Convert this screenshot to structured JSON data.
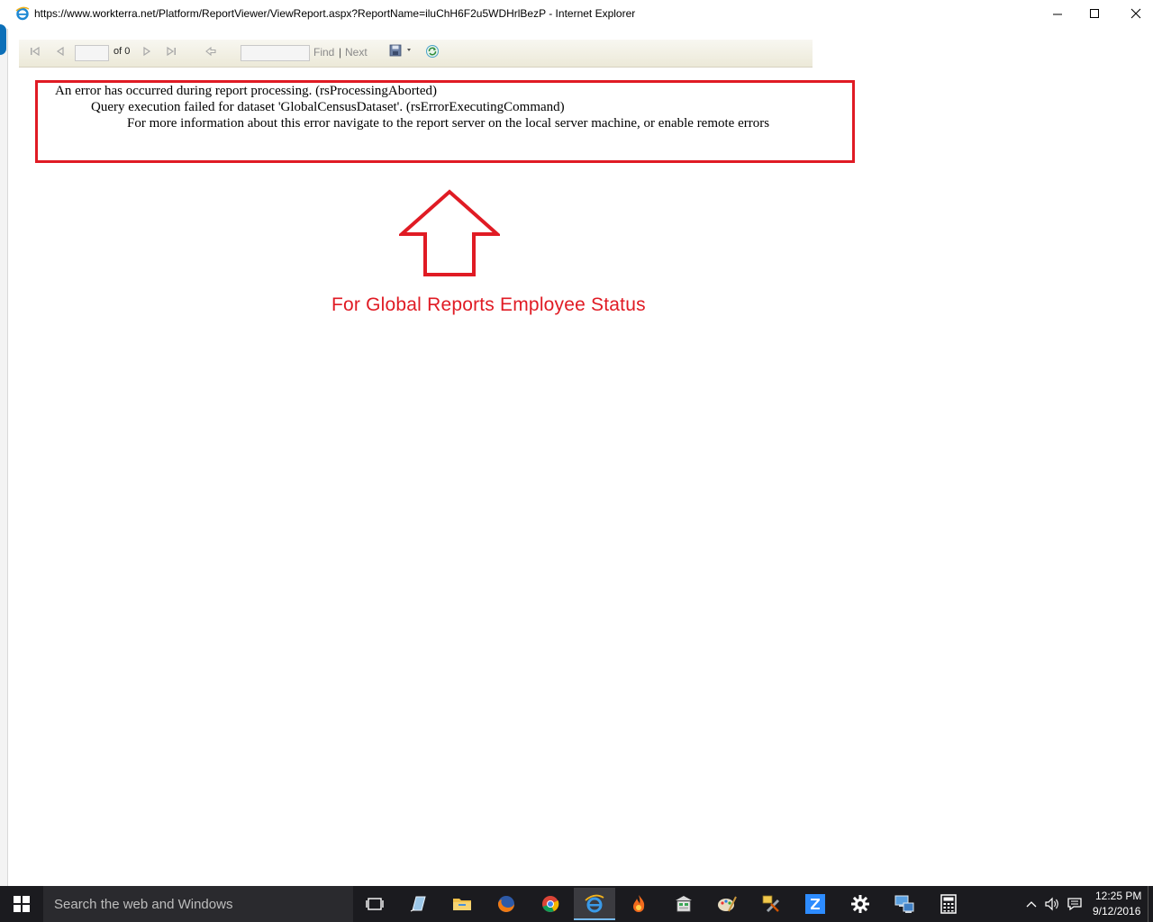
{
  "window": {
    "title": "https://www.workterra.net/Platform/ReportViewer/ViewReport.aspx?ReportName=iluChH6F2u5WDHrlBezP - Internet Explorer"
  },
  "toolbar": {
    "page_value": "",
    "page_of": "of 0",
    "find_value": "",
    "find_label": "Find",
    "separator": "|",
    "next_label": "Next"
  },
  "error": {
    "line1": "An error has occurred during report processing. (rsProcessingAborted)",
    "line2": "Query execution failed for dataset 'GlobalCensusDataset'. (rsErrorExecutingCommand)",
    "line3": "For more information about this error navigate to the report server on the local server machine, or enable remote errors"
  },
  "annotation": {
    "text": "For Global Reports Employee Status",
    "color": "#e01b24"
  },
  "taskbar": {
    "search_placeholder": "Search the web and Windows",
    "apps": [
      "task-view",
      "notepad",
      "file-explorer",
      "firefox",
      "chrome",
      "internet-explorer",
      "app-flame",
      "spreadsheet",
      "paint",
      "tools",
      "zoom",
      "settings",
      "network-computer",
      "calculator"
    ],
    "active_app": "internet-explorer",
    "clock_time": "12:25 PM",
    "clock_date": "9/12/2016"
  },
  "colors": {
    "accent_red": "#e01b24",
    "taskbar_bg": "#1b1b1f",
    "toolbar_bg": "#ece9d8"
  }
}
